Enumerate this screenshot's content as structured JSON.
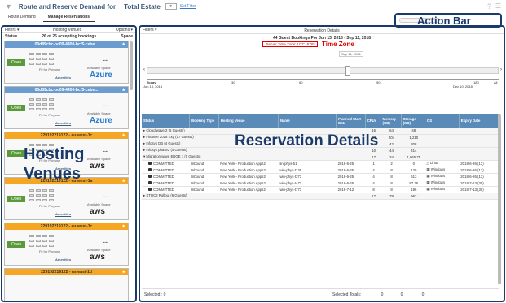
{
  "header": {
    "title": "Route and Reserve Demand for",
    "estate": "Total Estate",
    "set_filter": "Set Filter",
    "help": "?",
    "menu": "☰"
  },
  "tabs": [
    "Route Demand",
    "Manage Reservations"
  ],
  "action_bar": {
    "label": "Action Bar"
  },
  "left_panel": {
    "filters": "Filters ▾",
    "heading": "Hosting Venues",
    "options": "Options ▾",
    "status": "Status",
    "count": "26 of 26 accepting bookings",
    "space": "Space",
    "overlay_line1": "Hosting",
    "overlay_line2": "Venues",
    "open_label": "Open",
    "fit_label": "Fit for Purpose",
    "avail_label": "Available Space",
    "amen_label": "Amenities",
    "dash": "--",
    "venues": [
      {
        "name": "00d89cbc-bc09-4400-bcf5-cebe...",
        "logo": "Azure",
        "type": "azure"
      },
      {
        "name": "00d89cbc-bc09-4400-bcf5-cebe...",
        "logo": "Azure",
        "type": "azure"
      },
      {
        "name": "229192219122 - eu-west-1c",
        "logo": "aws",
        "type": "aws"
      },
      {
        "name": "229192219122 - eu-west-1a",
        "logo": "aws",
        "type": "aws"
      },
      {
        "name": "229192219122 - eu-west-1c",
        "logo": "aws",
        "type": "aws"
      },
      {
        "name": "229192219122 - us-east-1d",
        "logo": "aws",
        "type": "aws"
      }
    ]
  },
  "right_panel": {
    "filters": "Filters ▾",
    "title": "Reservation Details",
    "subtitle": "44 Guest Bookings For Jun 13, 2018 - Sep 11, 2018",
    "timezone": "Server Time Zone: UTC -5:00",
    "timezone_label": "Time Zone",
    "date_box": "Sep 11, 2018",
    "timeline": {
      "today": "Today",
      "start": "Jun 13, 2018",
      "end": "Dec 10, 2018",
      "ticks": [
        "30",
        "60",
        "90",
        "180",
        "All"
      ]
    },
    "columns": [
      "Status",
      "Booking Type",
      "Hosting Venue",
      "Name",
      "Planned Start Date",
      "CPUs",
      "Memory (GB)",
      "Storage (GB)",
      "OS",
      "Expiry Date"
    ],
    "groups": [
      {
        "label": "▸ Cloud wave 2 (5 Guests)",
        "cpus": "16",
        "mem": "64",
        "sto": "48"
      },
      {
        "label": "▸ Finance 2015 Exp (17 Guests)",
        "cpus": "44",
        "mem": "204",
        "sto": "1,210"
      },
      {
        "label": "▸ Infosys DB (4 Guests)",
        "cpus": "12",
        "mem": "42",
        "sto": "308"
      },
      {
        "label": "▸ Infosys phase2 (4 Guests)",
        "cpus": "10",
        "mem": "44",
        "sto": "414"
      },
      {
        "label": "▾ Migration wave EDGE 1 (5 Guests)",
        "cpus": "17",
        "mem": "34",
        "sto": "1,065.75"
      }
    ],
    "rows": [
      {
        "status": "COMMITTED",
        "type": "Inbound",
        "venue": "New York - Production Apps2",
        "name": "lin-phys-51",
        "date": "2018-6-25",
        "cpus": "1",
        "mem": "2",
        "sto": "0",
        "os": "Linux",
        "expiry": "2018-6-26 (13)"
      },
      {
        "status": "COMMITTED",
        "type": "Inbound",
        "venue": "New York - Production Apps2",
        "name": "win-phys-t139",
        "date": "2018-6-25",
        "cpus": "4",
        "mem": "8",
        "sto": "129",
        "os": "Windows",
        "expiry": "2018-6-26 (13)"
      },
      {
        "status": "COMMITTED",
        "type": "Inbound",
        "venue": "New York - Production Apps2",
        "name": "win-phys-t373",
        "date": "2018-6-25",
        "cpus": "4",
        "mem": "8",
        "sto": "613",
        "os": "Windows",
        "expiry": "2018-6-26 (13)"
      },
      {
        "status": "COMMITTED",
        "type": "Inbound",
        "venue": "New York - Production Apps2",
        "name": "win-phys-t471",
        "date": "2018-6-25",
        "cpus": "4",
        "mem": "8",
        "sto": "87.75",
        "os": "Windows",
        "expiry": "2018-7-13 (30)"
      },
      {
        "status": "COMMITTED",
        "type": "Inbound",
        "venue": "New York - Production Apps2",
        "name": "win-phys-t771",
        "date": "2018-7-12",
        "cpus": "8",
        "mem": "8",
        "sto": "196",
        "os": "Windows",
        "expiry": "2018-7-13 (30)"
      }
    ],
    "last_group": {
      "label": "▸ STOC2 Rollout (6 Guests)",
      "cpus": "17",
      "mem": "79",
      "sto": "962"
    },
    "overlay": "Reservation Details",
    "footer": {
      "selected": "Selected : 0",
      "totals_label": "Selected Totals:",
      "v1": "0",
      "v2": "0",
      "v3": "0"
    }
  }
}
